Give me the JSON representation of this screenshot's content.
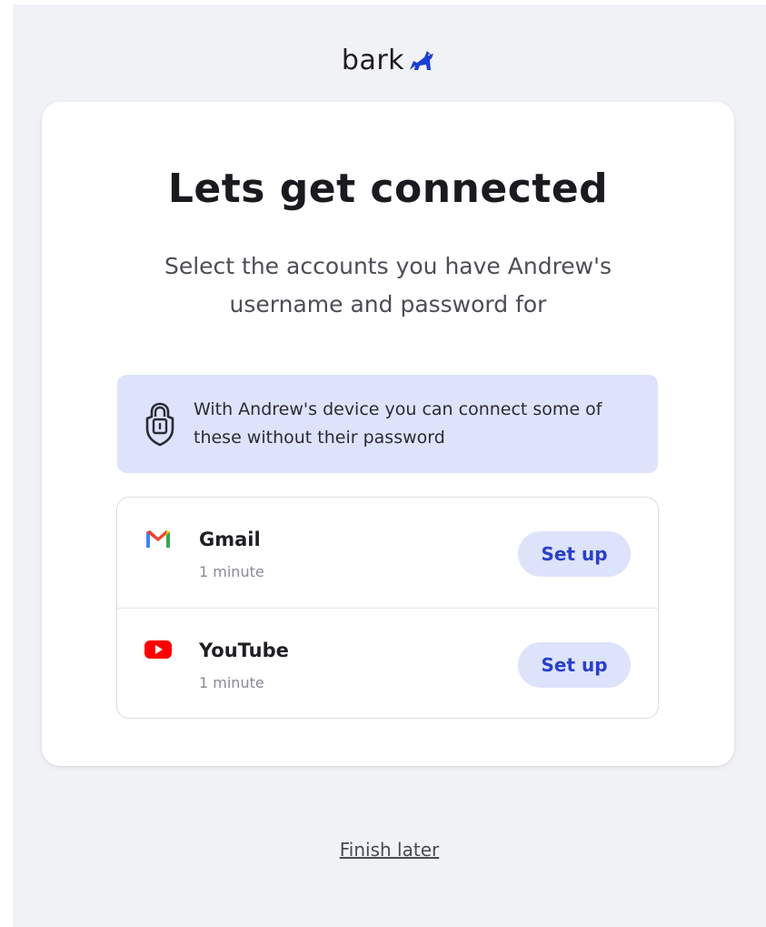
{
  "brand": {
    "name": "bark",
    "icon": "dog-icon",
    "accent_color": "#1a3fd0"
  },
  "main": {
    "title": "Lets get connected",
    "subtitle": "Select the accounts you have Andrew's username and password for",
    "info": {
      "icon": "lock-shield-icon",
      "text": "With Andrew's device you can connect some of these without their password"
    },
    "accounts": [
      {
        "name": "Gmail",
        "time": "1 minute",
        "button_label": "Set up",
        "icon": "gmail-icon"
      },
      {
        "name": "YouTube",
        "time": "1 minute",
        "button_label": "Set up",
        "icon": "youtube-icon"
      }
    ]
  },
  "footer": {
    "finish_later": "Finish later"
  },
  "colors": {
    "page_bg": "#f1f2f6",
    "card_bg": "#ffffff",
    "info_bg": "#dde3fb",
    "button_bg": "#dde3fb",
    "button_text": "#2a3fc9"
  }
}
